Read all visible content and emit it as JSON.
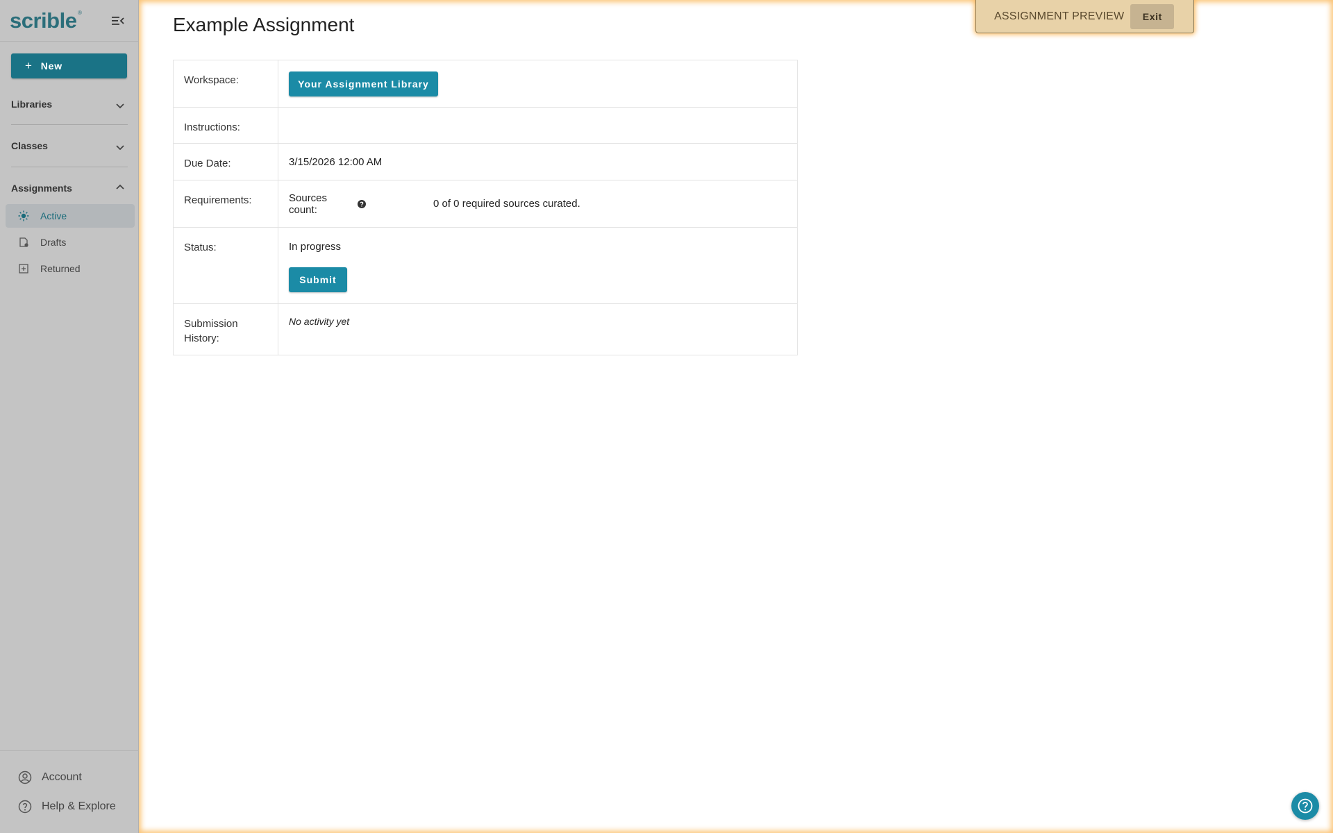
{
  "app": {
    "logo_text": "scrible",
    "logo_mark": "®"
  },
  "sidebar": {
    "new_label": "New",
    "sections": [
      {
        "label": "Libraries",
        "expanded": false
      },
      {
        "label": "Classes",
        "expanded": false
      },
      {
        "label": "Assignments",
        "expanded": true
      }
    ],
    "items": [
      {
        "label": "Active",
        "icon": "sun-icon",
        "selected": true
      },
      {
        "label": "Drafts",
        "icon": "draft-icon",
        "selected": false
      },
      {
        "label": "Returned",
        "icon": "returned-icon",
        "selected": false
      }
    ],
    "footer": [
      {
        "label": "Account",
        "icon": "account-icon"
      },
      {
        "label": "Help & Explore",
        "icon": "help-icon"
      }
    ]
  },
  "banner": {
    "text": "ASSIGNMENT PREVIEW",
    "exit_label": "Exit"
  },
  "page": {
    "title": "Example Assignment"
  },
  "details": {
    "workspace_label": "Workspace:",
    "workspace_button": "Your Assignment Library",
    "instructions_label": "Instructions:",
    "instructions_value": "",
    "due_label": "Due Date:",
    "due_value": "3/15/2026 12:00 AM",
    "requirements_label": "Requirements:",
    "sources_label": "Sources count:",
    "sources_value": "0 of 0 required sources curated.",
    "status_label": "Status:",
    "status_value": "In progress",
    "submit_label": "Submit",
    "history_label": "Submission History:",
    "history_value": "No activity yet"
  },
  "colors": {
    "accent": "#1b8ba6",
    "sidebar_bg": "#c4c4c4",
    "banner_bg": "#e8d2a8",
    "glow": "#faaf46"
  }
}
